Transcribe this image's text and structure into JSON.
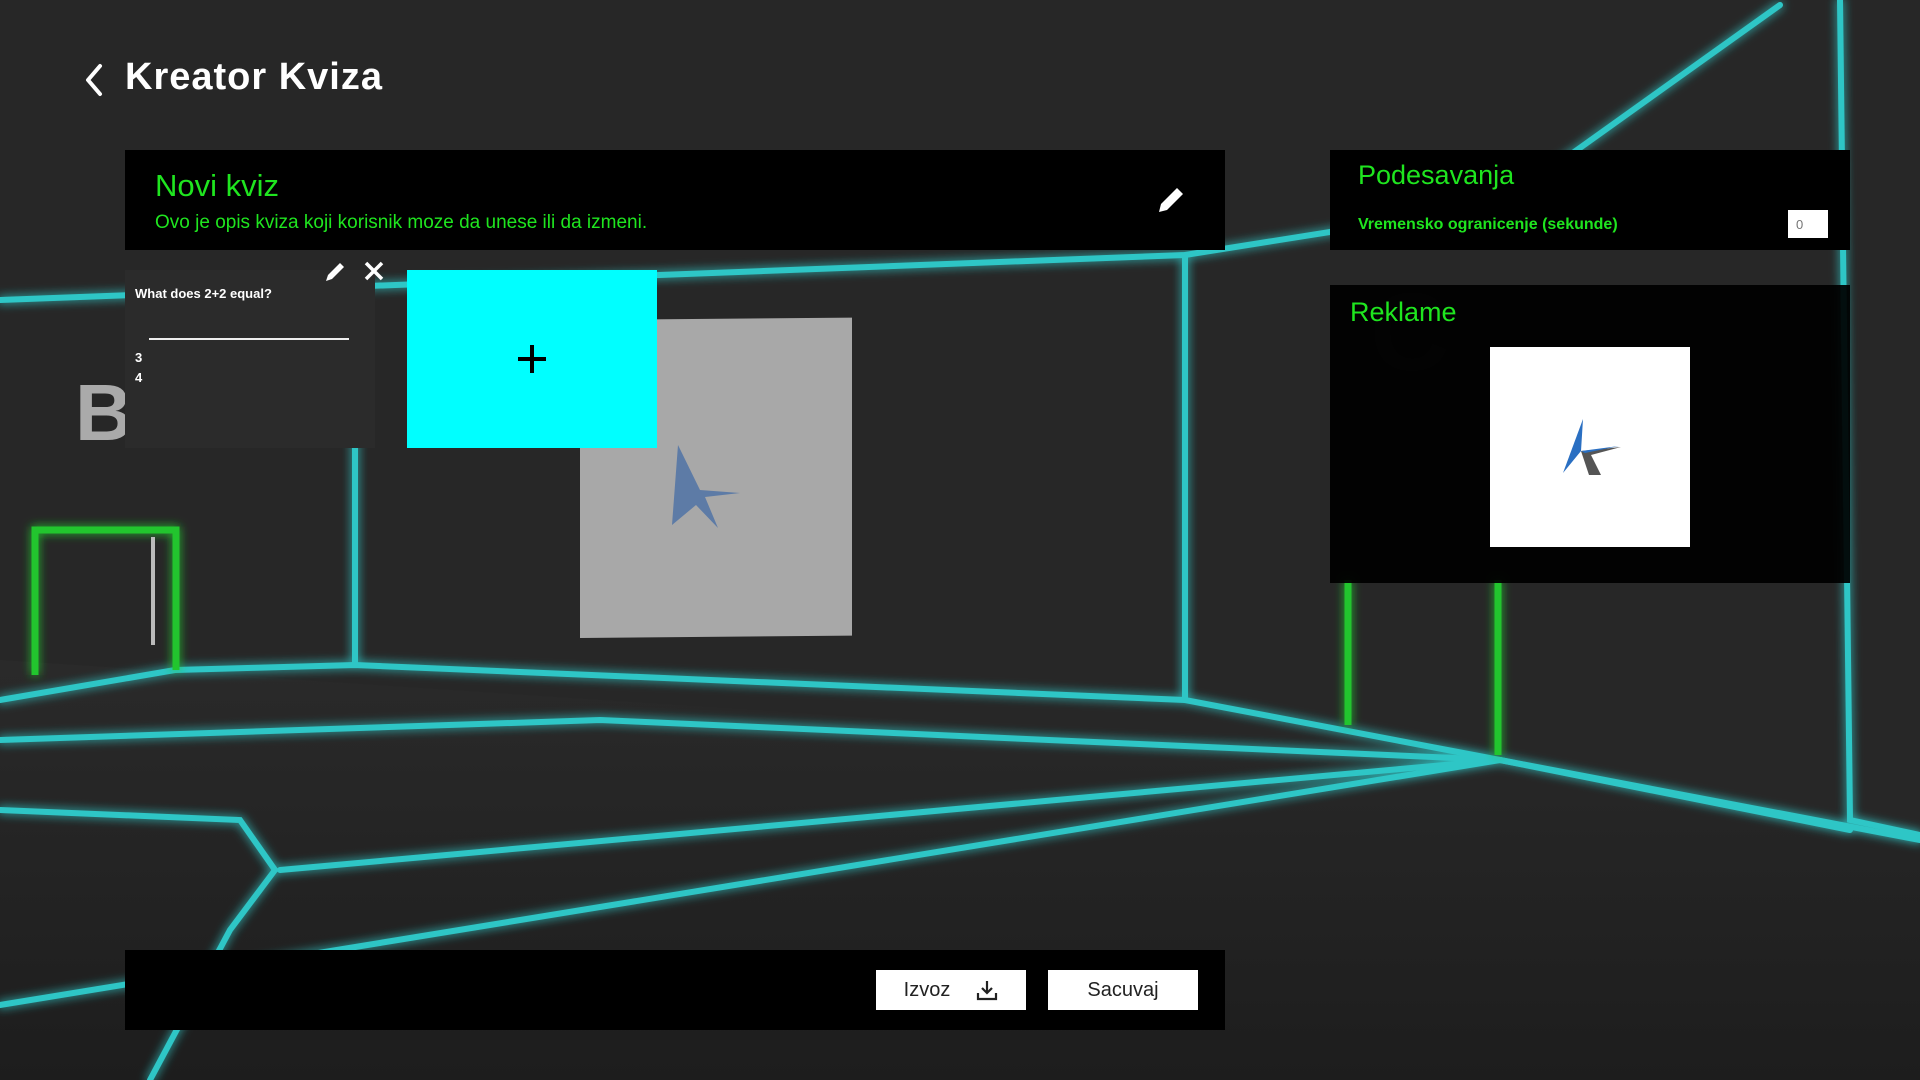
{
  "header": {
    "title": "Kreator Kviza",
    "back_icon": "chevron-left-icon"
  },
  "quiz": {
    "title": "Novi kviz",
    "description": "Ovo je opis kviza koji korisnik moze da unese ili da izmeni.",
    "edit_icon": "pencil-icon"
  },
  "questions": [
    {
      "text": "What does 2+2 equal?",
      "answers": [
        "3",
        "4"
      ]
    }
  ],
  "add_question": {
    "icon": "plus-icon"
  },
  "settings": {
    "title": "Podesavanja",
    "time_limit_label": "Vremensko ogranicenje (sekunde)",
    "time_limit_placeholder": "0"
  },
  "ads": {
    "title": "Reklame",
    "image_icon": "logo-icon"
  },
  "footer": {
    "export_label": "Izvoz",
    "export_icon": "download-icon",
    "save_label": "Sacuvaj"
  },
  "colors": {
    "accent_green": "#1fe51f",
    "accent_cyan": "#00ffff",
    "panel": "#000000",
    "card": "#2b2b2b"
  }
}
